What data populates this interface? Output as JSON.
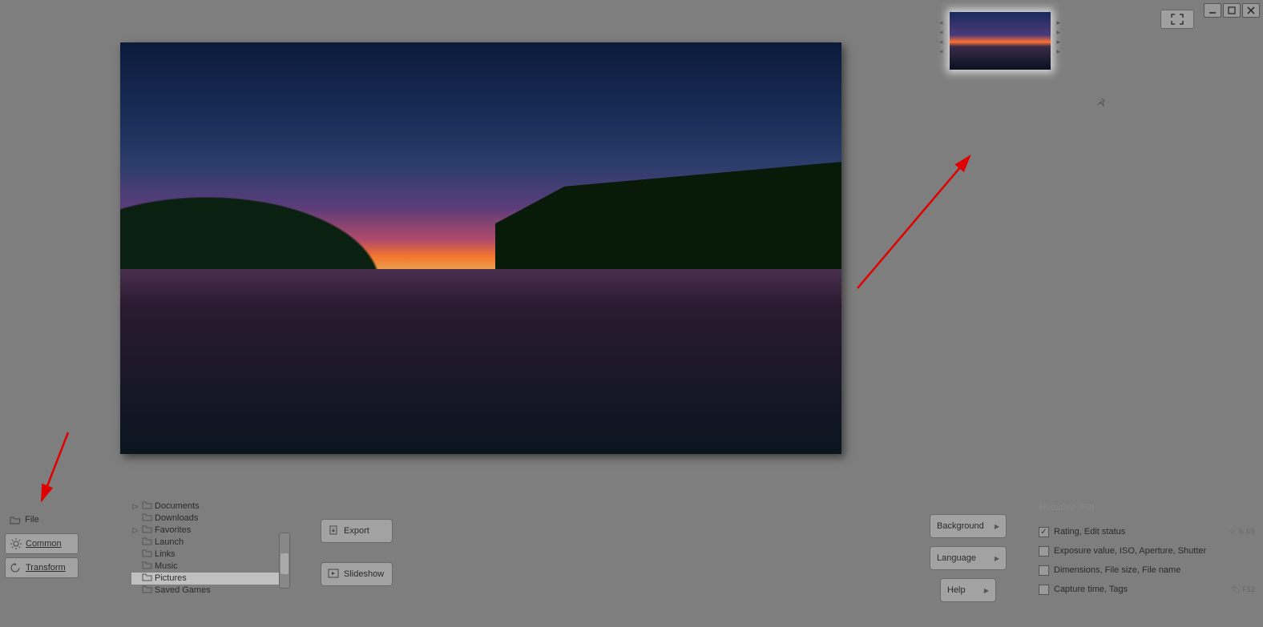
{
  "window": {
    "expand_title": "Expand"
  },
  "side_tabs": {
    "file": "File",
    "common": "Common",
    "transform": "Transform"
  },
  "folders": {
    "items": [
      "Documents",
      "Downloads",
      "Favorites",
      "Launch",
      "Links",
      "Music",
      "Pictures",
      "Saved Games"
    ]
  },
  "mid": {
    "export": "Export",
    "slideshow": "Slideshow"
  },
  "right": {
    "background": "Background",
    "language": "Language",
    "help": "Help"
  },
  "metadata": {
    "title": "Metadata (F8)",
    "rating": "Rating, Edit status",
    "rating_key": "F9",
    "exposure": "Exposure value, ISO, Aperture, Shutter",
    "dimensions": "Dimensions, File size, File name",
    "capture": "Capture time, Tags",
    "capture_key": "F12"
  }
}
